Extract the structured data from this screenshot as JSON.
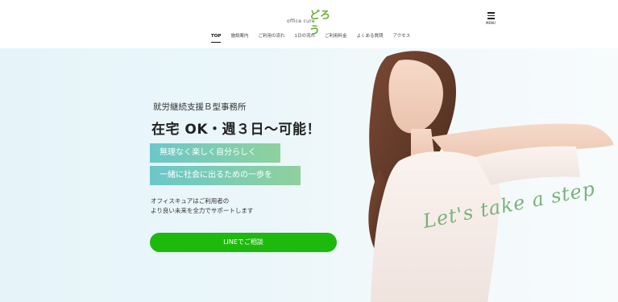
{
  "header": {
    "logo_kana": "どろう",
    "logo_sub": "office cure",
    "menu_label": "MENU"
  },
  "nav": {
    "items": [
      {
        "label": "TOP",
        "active": true
      },
      {
        "label": "施設案内"
      },
      {
        "label": "ご利用の流れ"
      },
      {
        "label": "1日の流れ"
      },
      {
        "label": "ご利用料金"
      },
      {
        "label": "よくある質問"
      },
      {
        "label": "アクセス"
      }
    ]
  },
  "hero": {
    "subtitle": "就労継続支援Ｂ型事務所",
    "title": "在宅 OK・週３日～可能！",
    "tags": [
      "無理なく楽しく自分らしく",
      "一緒に社会に出るための一歩を"
    ],
    "desc_lines": [
      "オフィスキュアはご利用者の",
      "より良い未来を全力でサポートします"
    ],
    "line_button": "LINEでご相談",
    "script_text": "Let's take a step"
  },
  "colors": {
    "accent_green": "#66b22e",
    "line_green": "#1db90d",
    "tag_gradient_start": "#6bc7c9",
    "tag_gradient_end": "#8fd19d",
    "hero_bg": "#e6f4f9"
  },
  "icons": {
    "menu": "hamburger-menu-icon"
  }
}
